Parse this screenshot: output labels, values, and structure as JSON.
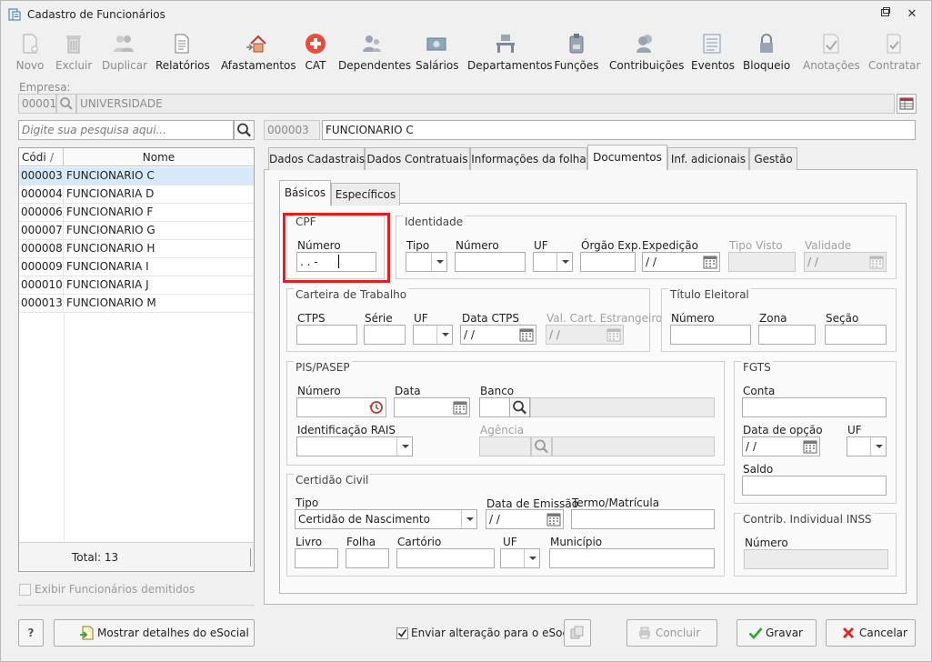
{
  "window": {
    "title": "Cadastro de Funcionários"
  },
  "toolbar": [
    {
      "label": "Novo",
      "icon": "new-doc-icon",
      "enabled": false
    },
    {
      "label": "Excluir",
      "icon": "trash-icon",
      "enabled": false
    },
    {
      "label": "Duplicar",
      "icon": "duplicate-users-icon",
      "enabled": false
    },
    {
      "label": "Relatórios",
      "icon": "report-icon",
      "enabled": true
    },
    {
      "label": "Afastamentos",
      "icon": "house-arrow-icon",
      "enabled": true
    },
    {
      "label": "CAT",
      "icon": "red-cross-icon",
      "enabled": true
    },
    {
      "label": "Dependentes",
      "icon": "dependents-icon",
      "enabled": true
    },
    {
      "label": "Salários",
      "icon": "money-icon",
      "enabled": true
    },
    {
      "label": "Departamentos",
      "icon": "desk-icon",
      "enabled": true
    },
    {
      "label": "Funções",
      "icon": "badge-icon",
      "enabled": true
    },
    {
      "label": "Contribuições",
      "icon": "people-icon",
      "enabled": true
    },
    {
      "label": "Eventos",
      "icon": "list-icon",
      "enabled": true
    },
    {
      "label": "Bloqueio",
      "icon": "lock-icon",
      "enabled": true
    },
    {
      "label": "Anotações",
      "icon": "notes-icon",
      "enabled": false
    },
    {
      "label": "Contratar",
      "icon": "contract-icon",
      "enabled": false
    }
  ],
  "empresa": {
    "label": "Empresa:",
    "code": "00001",
    "name": "UNIVERSIDADE"
  },
  "search": {
    "placeholder": "Digite sua pesquisa aqui..."
  },
  "current": {
    "code": "000003",
    "name": "FUNCIONARIO C"
  },
  "list": {
    "col_code": "Códi",
    "col_name": "Nome",
    "rows": [
      {
        "code": "000003",
        "name": "FUNCIONARIO C"
      },
      {
        "code": "000004",
        "name": "FUNCIONARIA D"
      },
      {
        "code": "000006",
        "name": "FUNCIONARIO F"
      },
      {
        "code": "000007",
        "name": "FUNCIONARIO G"
      },
      {
        "code": "000008",
        "name": "FUNCIONARIO H"
      },
      {
        "code": "000009",
        "name": "FUNCIONARIA I"
      },
      {
        "code": "000010",
        "name": "FUNCIONARIA J"
      },
      {
        "code": "000013",
        "name": "FUNCIONARIO M"
      }
    ],
    "total": "Total: 13"
  },
  "show_dismissed": "Exibir Funcionários demitidos",
  "tabs": [
    "Dados Cadastrais",
    "Dados Contratuais",
    "Informações da folha",
    "Documentos",
    "Inf. adicionais",
    "Gestão"
  ],
  "subtabs": [
    "Básicos",
    "Específicos"
  ],
  "cpf": {
    "title": "CPF",
    "numero_label": "Número",
    "numero_value": " .  .  -"
  },
  "identidade": {
    "title": "Identidade",
    "tipo": "Tipo",
    "numero": "Número",
    "uf": "UF",
    "orgao": "Órgão Exp.",
    "expedicao": "Expedição",
    "expedicao_value": " / /",
    "tipo_visto": "Tipo Visto",
    "validade": "Validade",
    "validade_value": " / /"
  },
  "ctps": {
    "title": "Carteira de Trabalho",
    "ctps": "CTPS",
    "serie": "Série",
    "uf": "UF",
    "data": "Data CTPS",
    "data_value": " / /",
    "val_cart": "Val. Cart. Estrangeiro",
    "val_cart_value": " / /"
  },
  "titulo": {
    "title": "Título Eleitoral",
    "numero": "Número",
    "zona": "Zona",
    "secao": "Seção"
  },
  "pis": {
    "title": "PIS/PASEP",
    "numero": "Número",
    "data": "Data",
    "banco": "Banco",
    "rais": "Identificação RAIS",
    "agencia": "Agência"
  },
  "fgts": {
    "title": "FGTS",
    "conta": "Conta",
    "data_opcao": "Data de opção",
    "data_opcao_value": " / /",
    "uf": "UF",
    "saldo": "Saldo"
  },
  "certidao": {
    "title": "Certidão Civil",
    "tipo": "Tipo",
    "tipo_value": "Certidão de Nascimento",
    "data_emissao": "Data de Emissão",
    "data_emissao_value": " / /",
    "termo": "Termo/Matrícula",
    "livro": "Livro",
    "folha": "Folha",
    "cartorio": "Cartório",
    "uf": "UF",
    "municipio": "Município"
  },
  "inss": {
    "title": "Contrib. Individual INSS",
    "numero": "Número"
  },
  "footer": {
    "help": "?",
    "esocial_details": "Mostrar detalhes do eSocial",
    "send_change": "Enviar alteração para o eSocial",
    "concluir": "Concluir",
    "gravar": "Gravar",
    "cancelar": "Cancelar"
  }
}
